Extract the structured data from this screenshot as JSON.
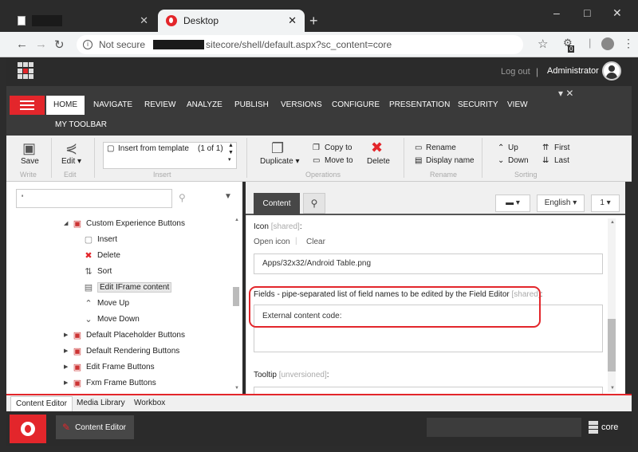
{
  "browser": {
    "tabs": [
      {
        "label": ""
      },
      {
        "label": "Desktop"
      }
    ],
    "new_tab": "+",
    "window_controls": {
      "minimize": "–",
      "maximize": "□",
      "close": "✕"
    },
    "security": "Not secure",
    "url_path": "sitecore/shell/default.aspx?sc_content=core",
    "extension_badge": "0"
  },
  "header": {
    "logout": "Log out",
    "separator": "|",
    "user": "Administrator"
  },
  "ribbon": {
    "tabs": [
      "HOME",
      "NAVIGATE",
      "REVIEW",
      "ANALYZE",
      "PUBLISH",
      "VERSIONS",
      "CONFIGURE",
      "PRESENTATION",
      "SECURITY",
      "VIEW"
    ],
    "toolbar_tab": "MY TOOLBAR",
    "controls": "▾ ✕",
    "write": {
      "save": "Save",
      "group": "Write"
    },
    "edit": {
      "edit": "Edit ▾",
      "group": "Edit"
    },
    "insert": {
      "item": "Insert from template",
      "count": "(1 of 1)",
      "group": "Insert"
    },
    "operations": {
      "duplicate": "Duplicate ▾",
      "copy_to": "Copy to",
      "move_to": "Move to",
      "delete": "Delete",
      "group": "Operations"
    },
    "rename": {
      "rename": "Rename",
      "display_name": "Display name",
      "group": "Rename"
    },
    "sorting": {
      "up": "Up",
      "down": "Down",
      "first": "First",
      "last": "Last",
      "group": "Sorting"
    }
  },
  "tree": {
    "search_value": "'",
    "items": [
      {
        "label": "Custom Experience Buttons",
        "icon": "buttons-icon",
        "glyph": "▣",
        "color": "#c33",
        "toggle": "◢",
        "indent": 1
      },
      {
        "label": "Insert",
        "icon": "insert-icon",
        "glyph": "▢",
        "color": "#888",
        "toggle": "",
        "indent": 2
      },
      {
        "label": "Delete",
        "icon": "delete-icon",
        "glyph": "✖",
        "color": "#e3262b",
        "toggle": "",
        "indent": 2
      },
      {
        "label": "Sort",
        "icon": "sort-icon",
        "glyph": "⇅",
        "color": "#555",
        "toggle": "",
        "indent": 2
      },
      {
        "label": "Edit IFrame content",
        "icon": "iframe-icon",
        "glyph": "▤",
        "color": "#666",
        "toggle": "",
        "indent": 2,
        "selected": true
      },
      {
        "label": "Move Up",
        "icon": "move-up-icon",
        "glyph": "⌃",
        "color": "#555",
        "toggle": "",
        "indent": 2
      },
      {
        "label": "Move Down",
        "icon": "move-down-icon",
        "glyph": "⌄",
        "color": "#555",
        "toggle": "",
        "indent": 2
      },
      {
        "label": "Default Placeholder Buttons",
        "icon": "buttons-icon",
        "glyph": "▣",
        "color": "#c33",
        "toggle": "▶",
        "indent": 1
      },
      {
        "label": "Default Rendering Buttons",
        "icon": "buttons-icon",
        "glyph": "▣",
        "color": "#c33",
        "toggle": "▶",
        "indent": 1
      },
      {
        "label": "Edit Frame Buttons",
        "icon": "buttons-icon",
        "glyph": "▣",
        "color": "#c33",
        "toggle": "▶",
        "indent": 1
      },
      {
        "label": "Fxm Frame Buttons",
        "icon": "buttons-icon",
        "glyph": "▣",
        "color": "#c33",
        "toggle": "▶",
        "indent": 1
      }
    ]
  },
  "editor": {
    "content_tab": "Content",
    "language": "English ▾",
    "version": "1 ▾",
    "icon_label": "Icon",
    "shared": "[shared]",
    "unversioned": "[unversioned]",
    "open_icon": "Open icon",
    "clear": "Clear",
    "icon_value": "Apps/32x32/Android Table.png",
    "fields_label": "Fields - pipe-separated list of field names to be edited by the Field Editor",
    "fields_value": "External content code:",
    "tooltip_label": "Tooltip",
    "colon": ":"
  },
  "bottom_tabs": [
    "Content Editor",
    "Media Library",
    "Workbox"
  ],
  "taskbar": {
    "app": "Content Editor",
    "database": "core"
  },
  "colors": {
    "accent": "#e3262b",
    "dark": "#2b2b2b"
  }
}
